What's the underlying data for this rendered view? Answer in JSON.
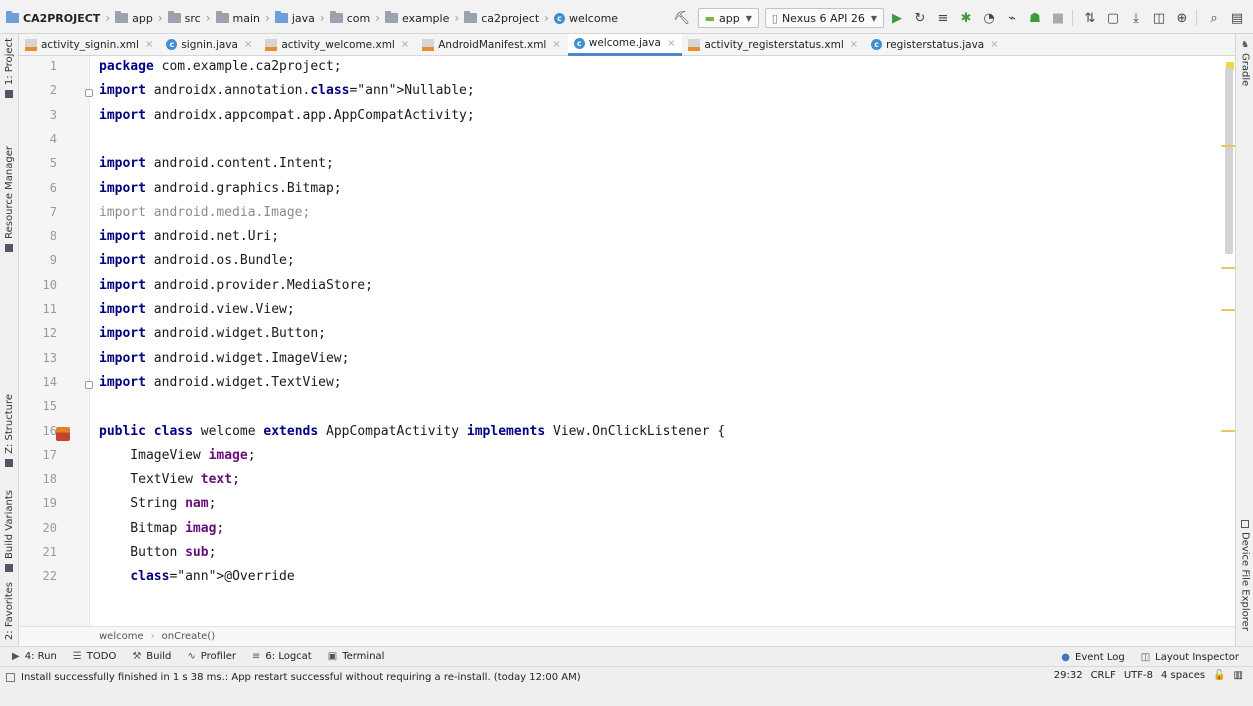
{
  "breadcrumbs": [
    "CA2PROJECT",
    "app",
    "src",
    "main",
    "java",
    "com",
    "example",
    "ca2project",
    "welcome"
  ],
  "toolbar": {
    "run_config": "app",
    "device": "Nexus 6 API 26"
  },
  "left_tools": [
    "1: Project",
    "Resource Manager",
    "Z: Structure",
    "Build Variants",
    "2: Favorites"
  ],
  "right_tools": [
    "Gradle",
    "Device File Explorer"
  ],
  "tabs": [
    {
      "label": "activity_signin.xml",
      "kind": "xml"
    },
    {
      "label": "signin.java",
      "kind": "java"
    },
    {
      "label": "activity_welcome.xml",
      "kind": "xml"
    },
    {
      "label": "AndroidManifest.xml",
      "kind": "xml"
    },
    {
      "label": "welcome.java",
      "kind": "java",
      "active": true
    },
    {
      "label": "activity_registerstatus.xml",
      "kind": "xml"
    },
    {
      "label": "registerstatus.java",
      "kind": "java"
    }
  ],
  "editor": {
    "line_numbers": [
      "1",
      "2",
      "3",
      "4",
      "5",
      "6",
      "7",
      "8",
      "9",
      "10",
      "11",
      "12",
      "13",
      "14",
      "15",
      "16",
      "17",
      "18",
      "19",
      "20",
      "21",
      "22"
    ],
    "lines": [
      "package com.example.ca2project;",
      "import androidx.annotation.Nullable;",
      "import androidx.appcompat.app.AppCompatActivity;",
      "",
      "import android.content.Intent;",
      "import android.graphics.Bitmap;",
      "import android.media.Image;",
      "import android.net.Uri;",
      "import android.os.Bundle;",
      "import android.provider.MediaStore;",
      "import android.view.View;",
      "import android.widget.Button;",
      "import android.widget.ImageView;",
      "import android.widget.TextView;",
      "",
      "public class welcome extends AppCompatActivity implements View.OnClickListener {",
      "    ImageView image;",
      "    TextView text;",
      "    String nam;",
      "    Bitmap imag;",
      "    Button sub;",
      "    @Override"
    ]
  },
  "code_path": [
    "welcome",
    "onCreate()"
  ],
  "tool_windows": [
    {
      "label": "4: Run",
      "icon": "run-icon"
    },
    {
      "label": "TODO",
      "icon": "todo-icon"
    },
    {
      "label": "Build",
      "icon": "build-icon"
    },
    {
      "label": "Profiler",
      "icon": "profiler-icon"
    },
    {
      "label": "6: Logcat",
      "icon": "logcat-icon"
    },
    {
      "label": "Terminal",
      "icon": "terminal-icon"
    }
  ],
  "tool_windows_right": [
    "Event Log",
    "Layout Inspector"
  ],
  "status": {
    "message": "Install successfully finished in 1 s 38 ms.: App restart successful without requiring a re-install. (today 12:00 AM)",
    "position": "29:32",
    "line_sep": "CRLF",
    "encoding": "UTF-8",
    "indent": "4 spaces"
  },
  "colors": {
    "keyword": "#000080",
    "field": "#660e7a",
    "annotation": "#808000",
    "unused_import": "#8c8c8c",
    "accent": "#4a88c7"
  }
}
